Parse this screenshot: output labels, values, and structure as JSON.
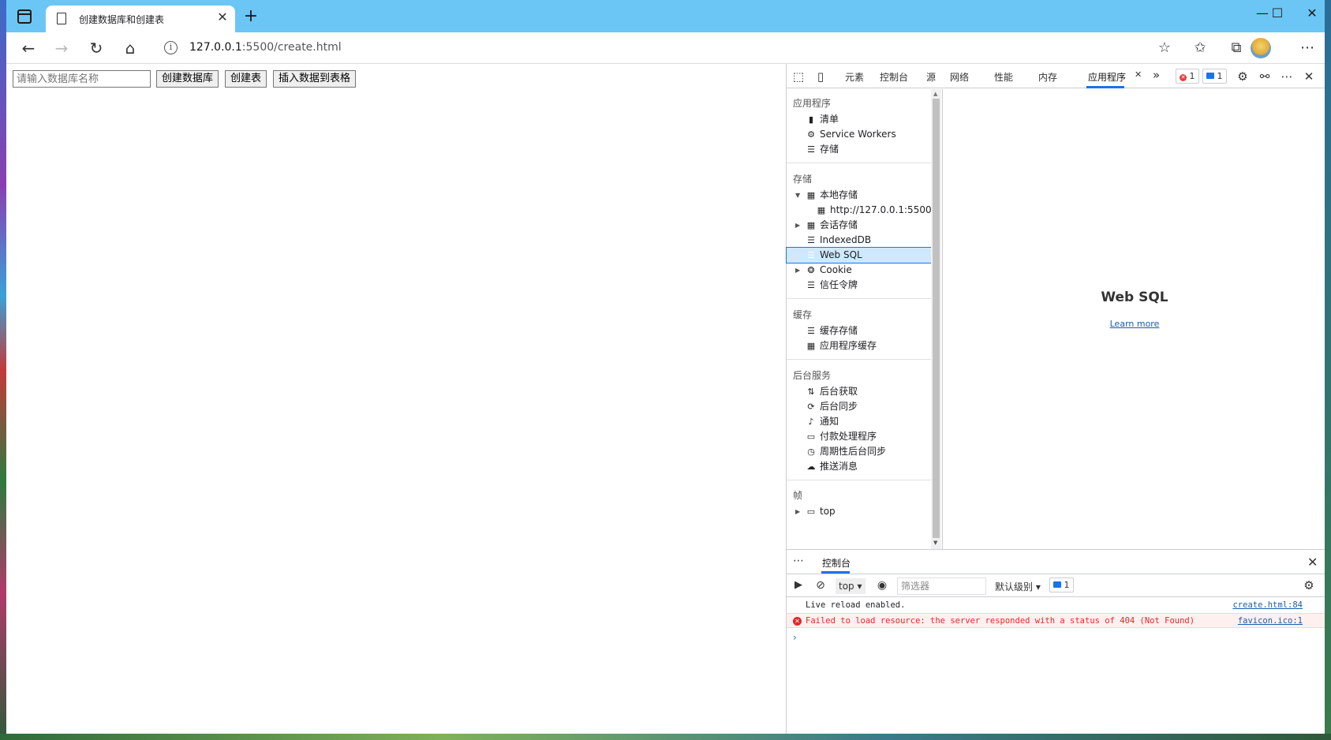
{
  "browser": {
    "tab_title": "创建数据库和创建表",
    "tab_close": "✕",
    "new_tab": "+",
    "url_host": "127.0.0.1",
    "url_rest": ":5500/create.html",
    "window_controls": {
      "minimize": "—",
      "maximize": "☐",
      "close": "✕"
    }
  },
  "page": {
    "input_placeholder": "请输入数据库名称",
    "buttons": [
      "创建数据库",
      "创建表",
      "插入数据到表格"
    ]
  },
  "devtools": {
    "tabs": [
      "元素",
      "控制台",
      "源",
      "网络",
      "性能",
      "内存",
      "应用程序"
    ],
    "active_tab": "应用程序",
    "active_tab_close": "✕",
    "more_tabs": "»",
    "error_count": "1",
    "message_count": "1",
    "sidebar": {
      "sections": {
        "application": "应用程序",
        "storage": "存储",
        "cache": "缓存",
        "background": "后台服务",
        "frames": "帧"
      },
      "application_items": [
        {
          "icon": "document-icon",
          "label": "清单"
        },
        {
          "icon": "gear-icon",
          "label": "Service Workers"
        },
        {
          "icon": "database-icon",
          "label": "存储"
        }
      ],
      "storage_items": {
        "local_storage": "本地存储",
        "local_origin": "http://127.0.0.1:5500",
        "session_storage": "会话存储",
        "indexeddb": "IndexedDB",
        "websql": "Web SQL",
        "cookie": "Cookie",
        "trust_tokens": "信任令牌"
      },
      "cache_items": [
        "缓存存储",
        "应用程序缓存"
      ],
      "background_items": [
        "后台获取",
        "后台同步",
        "通知",
        "付款处理程序",
        "周期性后台同步",
        "推送消息"
      ],
      "frames_items": [
        "top"
      ]
    },
    "main": {
      "title": "Web SQL",
      "link": "Learn more"
    },
    "drawer": {
      "tab": "控制台",
      "context": "top",
      "filter_placeholder": "筛选器",
      "level": "默认级别",
      "message_badge": "1",
      "messages": [
        {
          "type": "log",
          "text": "Live reload enabled.",
          "source": "create.html:84"
        },
        {
          "type": "error",
          "text": "Failed to load resource: the server responded with a status of 404 (Not Found)",
          "source": "favicon.ico:1"
        }
      ],
      "prompt": "›"
    }
  }
}
